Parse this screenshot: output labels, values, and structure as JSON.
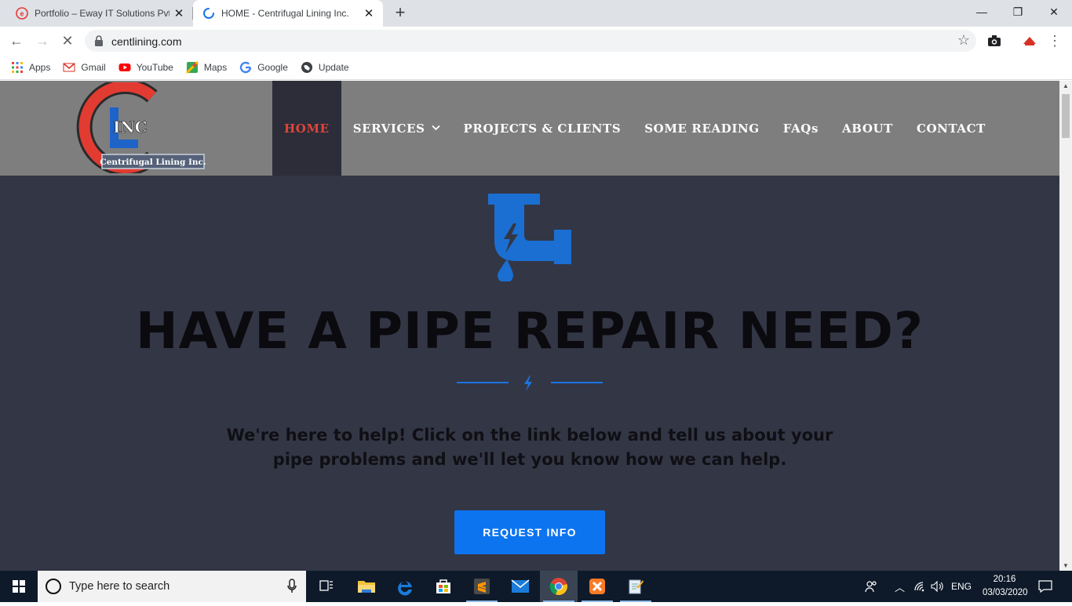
{
  "browser": {
    "tabs": [
      {
        "title": "Portfolio – Eway IT Solutions Pvt"
      },
      {
        "title": "HOME - Centrifugal Lining Inc."
      }
    ],
    "url": "centlining.com",
    "bookmarks": [
      {
        "label": "Apps",
        "icon": "apps-grid-icon"
      },
      {
        "label": "Gmail",
        "icon": "gmail-icon"
      },
      {
        "label": "YouTube",
        "icon": "youtube-icon"
      },
      {
        "label": "Maps",
        "icon": "maps-icon"
      },
      {
        "label": "Google",
        "icon": "google-icon"
      },
      {
        "label": "Update",
        "icon": "globe-icon"
      }
    ]
  },
  "site": {
    "logo_text": "Centrifugal Lining Inc.",
    "logo_mark": "INC",
    "nav": [
      {
        "label": "HOME",
        "active": true
      },
      {
        "label": "SERVICES",
        "has_dropdown": true
      },
      {
        "label": "PROJECTS & CLIENTS"
      },
      {
        "label": "SOME READING"
      },
      {
        "label": "FAQs"
      },
      {
        "label": "ABOUT"
      },
      {
        "label": "CONTACT"
      }
    ],
    "hero": {
      "headline": "HAVE A PIPE REPAIR NEED?",
      "tagline": "We're here to help! Click on the link below and tell us about your pipe problems and we'll let you know how we can help.",
      "cta": "REQUEST INFO"
    },
    "colors": {
      "header_bg": "#7e7e7e",
      "hero_bg": "#333645",
      "nav_active_bg": "#2c2d39",
      "nav_active_text": "#e0453a",
      "accent_blue": "#0d74f0"
    }
  },
  "taskbar": {
    "search_placeholder": "Type here to search",
    "language": "ENG",
    "time": "20:16",
    "date": "03/03/2020"
  }
}
